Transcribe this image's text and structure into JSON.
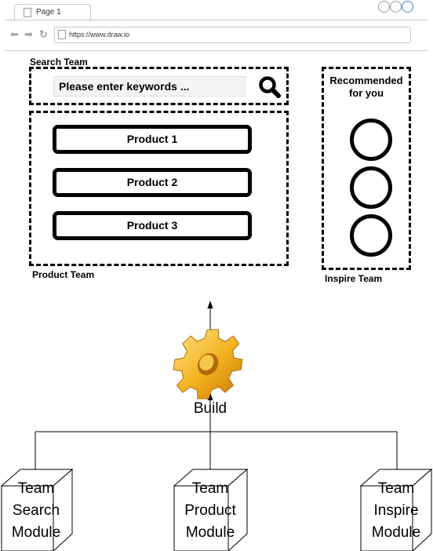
{
  "browser": {
    "tab_title": "Page 1",
    "url": "https://www.draw.io"
  },
  "search_section": {
    "label": "Search Team",
    "input_text": "Please enter keywords ..."
  },
  "product_section": {
    "label": "Product Team",
    "products": [
      "Product 1",
      "Product 2",
      "Product 3"
    ]
  },
  "inspire_section": {
    "label": "Inspire Team",
    "title": "Recommended for you"
  },
  "build": {
    "label": "Build"
  },
  "modules": [
    {
      "lines": [
        "Team",
        "Search",
        "Module"
      ]
    },
    {
      "lines": [
        "Team",
        "Product",
        "Module"
      ]
    },
    {
      "lines": [
        "Team",
        "Inspire",
        "Module"
      ]
    }
  ]
}
